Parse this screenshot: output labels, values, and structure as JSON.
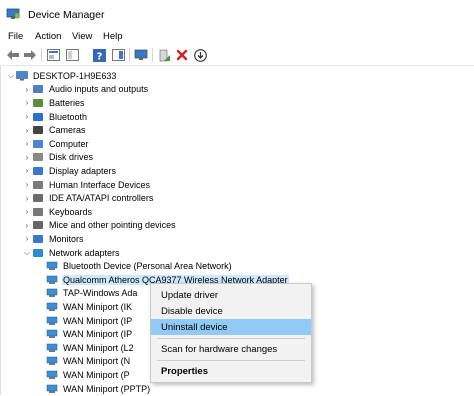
{
  "window": {
    "title": "Device Manager",
    "icon": "device-manager-icon"
  },
  "menu": [
    "File",
    "Action",
    "View",
    "Help"
  ],
  "toolbar": [
    "back-arrow-icon",
    "forward-arrow-icon",
    "properties-icon",
    "show-hide-console-icon",
    "help-icon",
    "action-pane-icon",
    "monitor-icon",
    "update-driver-icon",
    "uninstall-x-icon",
    "download-icon"
  ],
  "tree": {
    "root": "DESKTOP-1H9E633",
    "categories": [
      {
        "label": "Audio inputs and outputs",
        "icon": "speaker-icon"
      },
      {
        "label": "Batteries",
        "icon": "battery-icon"
      },
      {
        "label": "Bluetooth",
        "icon": "bluetooth-icon"
      },
      {
        "label": "Cameras",
        "icon": "camera-icon"
      },
      {
        "label": "Computer",
        "icon": "computer-icon"
      },
      {
        "label": "Disk drives",
        "icon": "disk-icon"
      },
      {
        "label": "Display adapters",
        "icon": "display-icon"
      },
      {
        "label": "Human Interface Devices",
        "icon": "hid-icon"
      },
      {
        "label": "IDE ATA/ATAPI controllers",
        "icon": "ide-icon"
      },
      {
        "label": "Keyboards",
        "icon": "keyboard-icon"
      },
      {
        "label": "Mice and other pointing devices",
        "icon": "mouse-icon"
      },
      {
        "label": "Monitors",
        "icon": "monitor-icon"
      },
      {
        "label": "Network adapters",
        "icon": "network-icon"
      }
    ],
    "network_children": [
      "Bluetooth Device (Personal Area Network)",
      "Qualcomm Atheros QCA9377 Wireless Network Adapter",
      "TAP-Windows Ada",
      "WAN Miniport (IK",
      "WAN Miniport (IP",
      "WAN Miniport (IP",
      "WAN Miniport (L2",
      "WAN Miniport (N",
      "WAN Miniport (P",
      "WAN Miniport (PPTP)"
    ]
  },
  "context_menu": {
    "items": [
      "Update driver",
      "Disable device",
      "Uninstall device",
      "Scan for hardware changes",
      "Properties"
    ],
    "highlighted": "Uninstall device"
  },
  "colors": {
    "selection": "#cde8ff",
    "highlight": "#91c9f7",
    "menu_bg": "#f2f2f2"
  }
}
